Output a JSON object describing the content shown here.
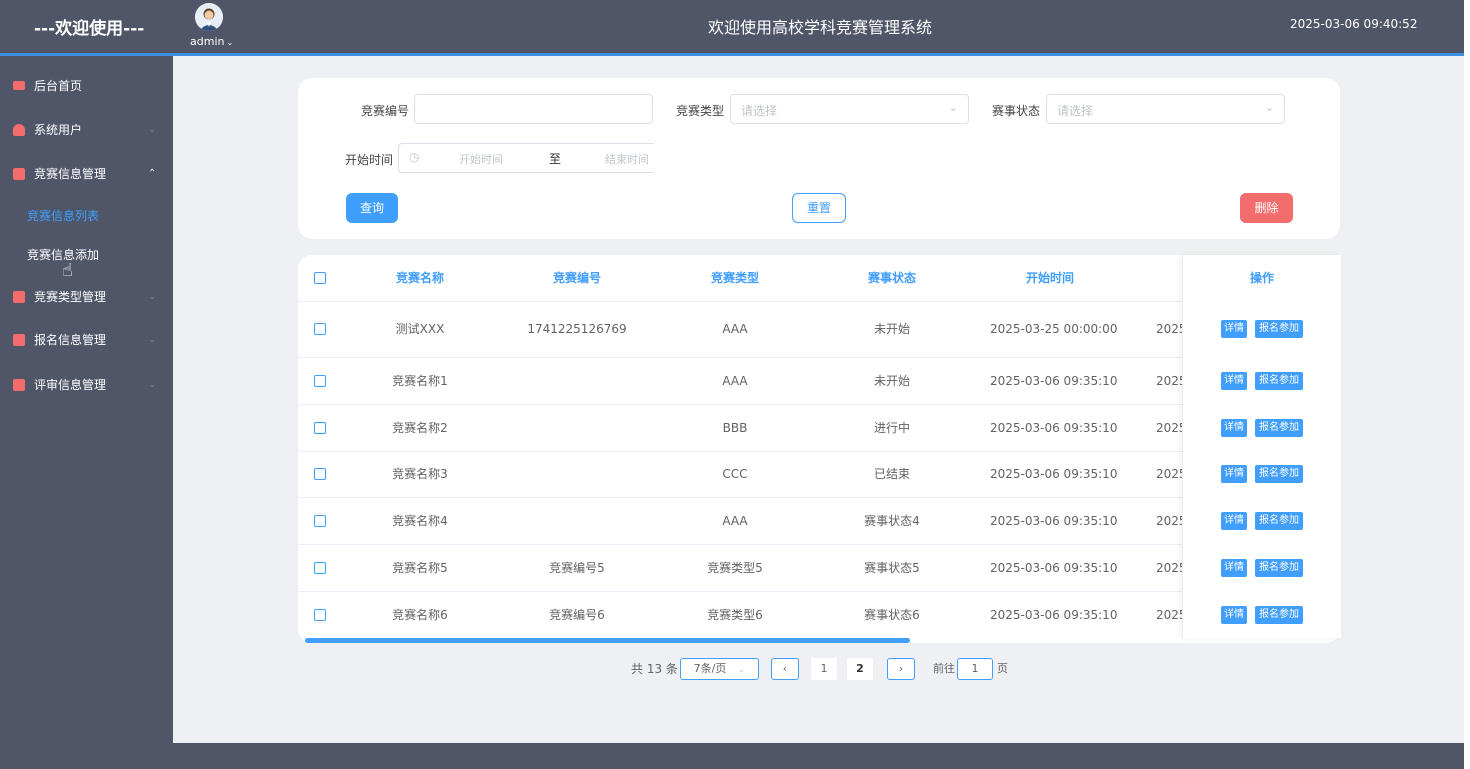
{
  "header": {
    "brand": "---欢迎使用---",
    "user": "admin",
    "title": "欢迎使用高校学科竞赛管理系统",
    "datetime": "2025-03-06 09:40:52"
  },
  "sidebar": {
    "items": [
      {
        "label": "后台首页"
      },
      {
        "label": "系统用户"
      },
      {
        "label": "竞赛信息管理"
      },
      {
        "label": "竞赛类型管理"
      },
      {
        "label": "报名信息管理"
      },
      {
        "label": "评审信息管理"
      }
    ],
    "sub_items": [
      {
        "label": "竞赛信息列表"
      },
      {
        "label": "竞赛信息添加"
      }
    ]
  },
  "search": {
    "code_label": "竞赛编号",
    "type_label": "竞赛类型",
    "type_placeholder": "请选择",
    "status_label": "赛事状态",
    "status_placeholder": "请选择",
    "time_label": "开始时间",
    "start_placeholder": "开始时间",
    "range_sep": "至",
    "end_placeholder": "结束时间",
    "query_btn": "查询",
    "reset_btn": "重置",
    "delete_btn": "删除"
  },
  "table": {
    "headers": [
      "竞赛名称",
      "竞赛编号",
      "竞赛类型",
      "赛事状态",
      "开始时间",
      "操作"
    ],
    "rows": [
      {
        "name": "测试XXX",
        "code": "1741225126769",
        "type": "AAA",
        "status": "未开始",
        "start": "2025-03-25 00:00:00",
        "end_partial": "2025-"
      },
      {
        "name": "竞赛名称1",
        "code": "",
        "type": "AAA",
        "status": "未开始",
        "start": "2025-03-06 09:35:10",
        "end_partial": "2025-"
      },
      {
        "name": "竞赛名称2",
        "code": "",
        "type": "BBB",
        "status": "进行中",
        "start": "2025-03-06 09:35:10",
        "end_partial": "2025-"
      },
      {
        "name": "竞赛名称3",
        "code": "",
        "type": "CCC",
        "status": "已结束",
        "start": "2025-03-06 09:35:10",
        "end_partial": "2025-"
      },
      {
        "name": "竞赛名称4",
        "code": "",
        "type": "AAA",
        "status": "赛事状态4",
        "start": "2025-03-06 09:35:10",
        "end_partial": "2025-"
      },
      {
        "name": "竞赛名称5",
        "code": "竞赛编号5",
        "type": "竞赛类型5",
        "status": "赛事状态5",
        "start": "2025-03-06 09:35:10",
        "end_partial": "2025-"
      },
      {
        "name": "竞赛名称6",
        "code": "竞赛编号6",
        "type": "竞赛类型6",
        "status": "赛事状态6",
        "start": "2025-03-06 09:35:10",
        "end_partial": "2025-"
      }
    ],
    "detail_btn": "详情",
    "join_btn": "报名参加"
  },
  "pagination": {
    "total": "共 13 条",
    "page_size": "7条/页",
    "pages": [
      "1",
      "2"
    ],
    "goto_label": "前往",
    "goto_value": "1",
    "page_unit": "页"
  },
  "colors": {
    "accent": "#409eff",
    "sidebar": "#4f5668",
    "danger": "#f56c6c"
  }
}
